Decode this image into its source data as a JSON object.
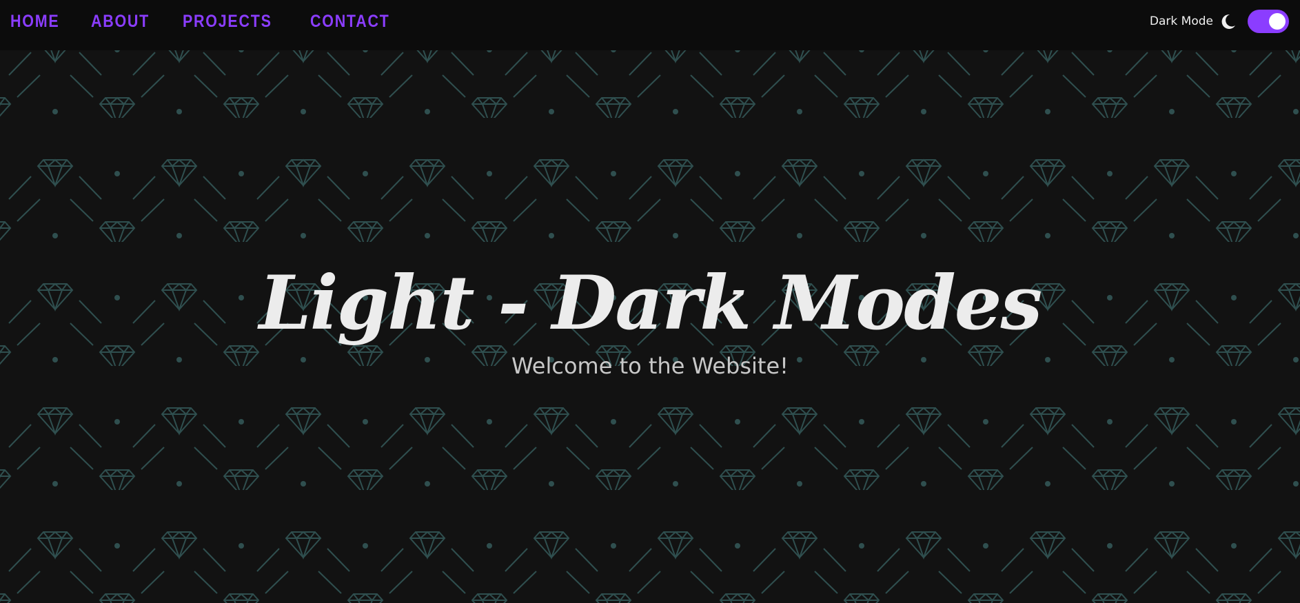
{
  "nav": {
    "links": [
      "HOME",
      "ABOUT",
      "PROJECTS",
      "CONTACT"
    ]
  },
  "theme_toggle": {
    "label": "Dark Mode",
    "icon": "moon-icon",
    "state": "on"
  },
  "hero": {
    "title": "Light - Dark Modes",
    "subtitle": "Welcome to the Website!"
  },
  "colors": {
    "background": "#121212",
    "navbar": "#0c0c0c",
    "accent": "#8b3dff",
    "pattern": "#2c4a4a",
    "text": "#ececec"
  }
}
